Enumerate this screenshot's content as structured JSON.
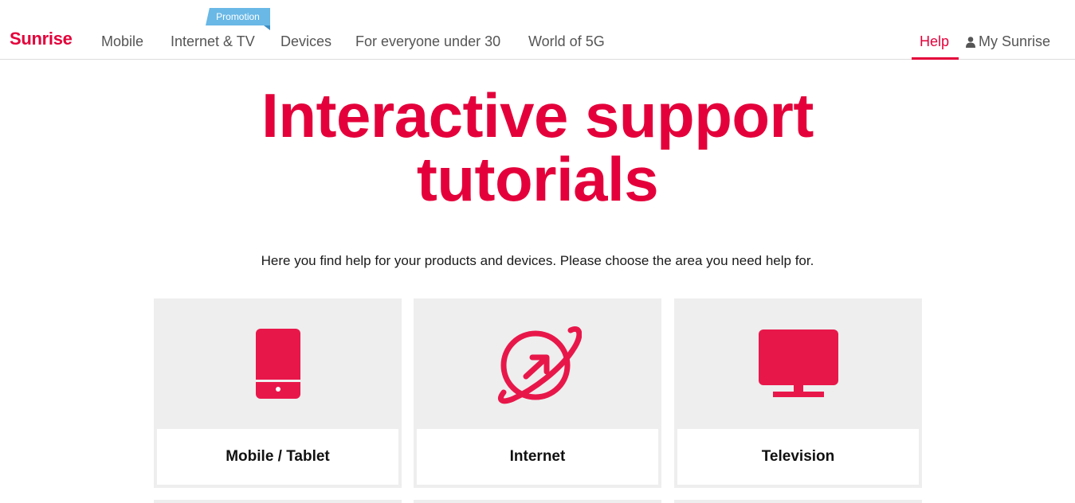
{
  "header": {
    "logo": "Sunrise",
    "nav": [
      {
        "label": "Mobile"
      },
      {
        "label": "Internet & TV"
      },
      {
        "label": "Devices"
      },
      {
        "label": "For everyone under 30"
      },
      {
        "label": "World of 5G"
      }
    ],
    "promo_badge": "Promotion",
    "help_label": "Help",
    "account_label": "My Sunrise",
    "account_icon": "user-icon"
  },
  "hero": {
    "title_line1": "Interactive support",
    "title_line2": "tutorials",
    "intro": "Here you find help for your products and devices. Please choose the area you need help for."
  },
  "cards": [
    {
      "label": "Mobile / Tablet",
      "icon": "tablet-icon"
    },
    {
      "label": "Internet",
      "icon": "globe-icon"
    },
    {
      "label": "Television",
      "icon": "tv-icon"
    }
  ],
  "colors": {
    "brand": "#e4003a",
    "promo": "#69b8e6",
    "card_bg": "#eeeeee",
    "nav_text": "#555555"
  }
}
